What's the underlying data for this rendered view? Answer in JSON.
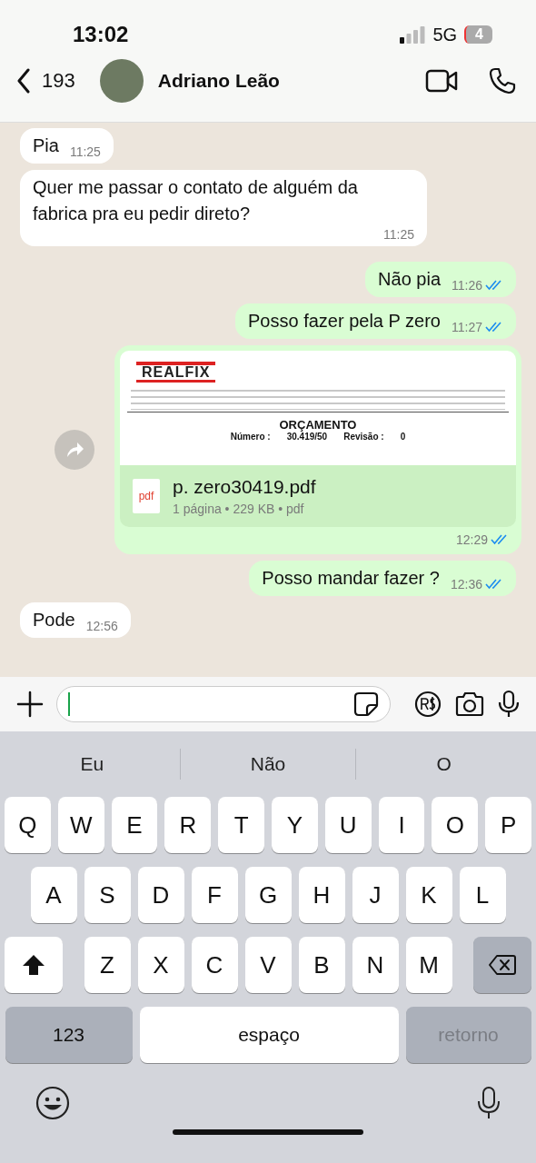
{
  "status_bar": {
    "time": "13:02",
    "network": "5G",
    "battery": "4"
  },
  "header": {
    "back_count": "193",
    "contact_name": "Adriano Leão"
  },
  "messages": [
    {
      "kind": "text",
      "sent": false,
      "text": "Pia",
      "time": "11:25"
    },
    {
      "kind": "text",
      "sent": false,
      "text": "Quer me passar o contato de alguém da fabrica pra eu pedir direto?",
      "time": "11:25"
    },
    {
      "kind": "text",
      "sent": true,
      "text": "Não pia",
      "time": "11:26",
      "read": true
    },
    {
      "kind": "text",
      "sent": true,
      "text": "Posso fazer pela P zero",
      "time": "11:27",
      "read": true
    },
    {
      "kind": "document",
      "sent": true,
      "time": "12:29",
      "read": true,
      "preview": {
        "logo": "REALFIX",
        "title": "ORÇAMENTO",
        "fields": [
          "Número :",
          "30.419/50",
          "Revisão :",
          "0"
        ]
      },
      "file_type": "pdf",
      "file_name": "p. zero30419.pdf",
      "file_meta": "1 página • 229 KB • pdf"
    },
    {
      "kind": "text",
      "sent": true,
      "text": "Posso mandar fazer ?",
      "time": "12:36",
      "read": true
    },
    {
      "kind": "text",
      "sent": false,
      "text": "Pode",
      "time": "12:56"
    }
  ],
  "suggestions": [
    "Eu",
    "Não",
    "O"
  ],
  "keyboard": {
    "rows": [
      [
        "Q",
        "W",
        "E",
        "R",
        "T",
        "Y",
        "U",
        "I",
        "O",
        "P"
      ],
      [
        "A",
        "S",
        "D",
        "F",
        "G",
        "H",
        "J",
        "K",
        "L"
      ],
      [
        "Z",
        "X",
        "C",
        "V",
        "B",
        "N",
        "M"
      ]
    ],
    "bottom": [
      {
        "kind": "mode",
        "label": "123"
      },
      {
        "kind": "space",
        "label": "espaço"
      },
      {
        "kind": "return",
        "label": "retorno",
        "disabled": true
      }
    ]
  }
}
